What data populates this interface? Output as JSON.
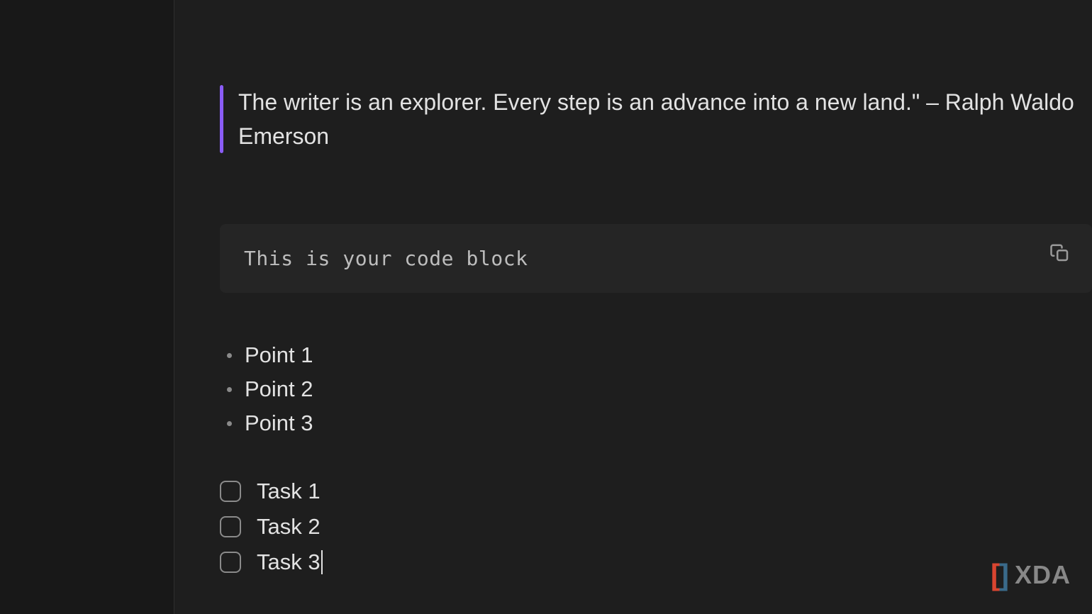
{
  "blockquote": {
    "text": "The writer is an explorer. Every step is an advance into a new land.\" – Ralph Waldo Emerson"
  },
  "code_block": {
    "text": "This is your code block"
  },
  "bullets": [
    "Point 1",
    "Point 2",
    "Point 3"
  ],
  "tasks": [
    {
      "label": "Task 1",
      "checked": false
    },
    {
      "label": "Task 2",
      "checked": false
    },
    {
      "label": "Task 3",
      "checked": false,
      "has_cursor": true
    }
  ],
  "watermark": {
    "text": "XDA"
  }
}
